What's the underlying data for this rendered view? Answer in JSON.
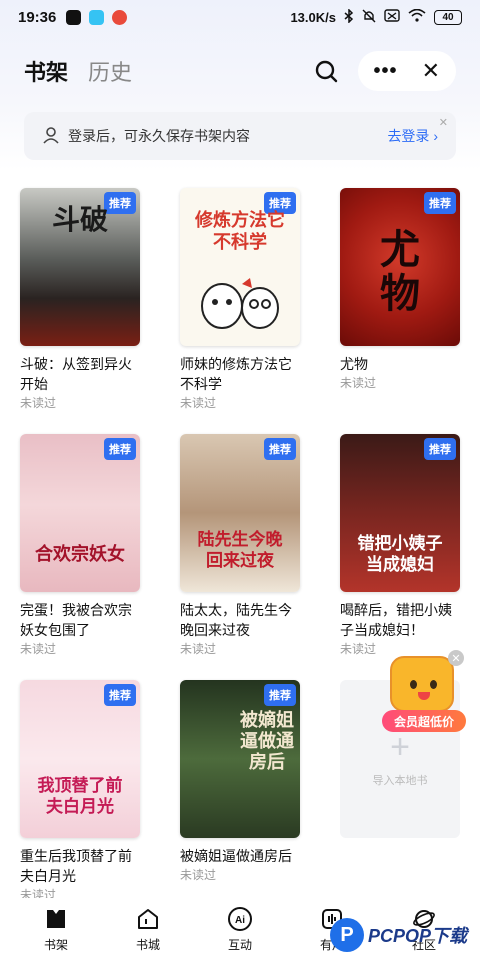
{
  "status_bar": {
    "time": "19:36",
    "network_speed": "13.0K/s",
    "battery": "40"
  },
  "header": {
    "tabs": [
      {
        "label": "书架",
        "active": true
      },
      {
        "label": "历史",
        "active": false
      }
    ],
    "search_icon": "search-icon",
    "more_icon": "more-icon",
    "close_icon": "close-icon"
  },
  "login_banner": {
    "text": "登录后，可永久保存书架内容",
    "link": "去登录 ›"
  },
  "books": [
    {
      "title": "斗破：从签到异火开始",
      "status": "未读过",
      "badge": "推荐",
      "cover_text": "斗破"
    },
    {
      "title": "师妹的修炼方法它不科学",
      "status": "未读过",
      "badge": "推荐",
      "cover_text": "修炼方法它不科学"
    },
    {
      "title": "尤物",
      "status": "未读过",
      "badge": "推荐",
      "cover_text": "尤物"
    },
    {
      "title": "完蛋！我被合欢宗妖女包围了",
      "status": "未读过",
      "badge": "推荐",
      "cover_text": "合欢宗妖女"
    },
    {
      "title": "陆太太，陆先生今晚回来过夜",
      "status": "未读过",
      "badge": "推荐",
      "cover_text": "陆先生今晚回来过夜"
    },
    {
      "title": "喝醉后，错把小姨子当成媳妇！",
      "status": "未读过",
      "badge": "推荐",
      "cover_text": "错把小姨子当成媳妇"
    },
    {
      "title": "重生后我顶替了前夫白月光",
      "status": "未读过",
      "badge": "推荐",
      "cover_text": "我顶替了前夫白月光"
    },
    {
      "title": "被嫡姐逼做通房后",
      "status": "未读过",
      "badge": "推荐",
      "cover_text": "被嫡姐逼做通房后"
    }
  ],
  "import_card": {
    "plus": "+",
    "label": "导入本地书"
  },
  "promo": {
    "label": "会员超低价"
  },
  "bottom_nav": [
    {
      "label": "书架",
      "icon": "bookshelf-icon"
    },
    {
      "label": "书城",
      "icon": "bookstore-icon"
    },
    {
      "label": "互动",
      "icon": "ai-icon"
    },
    {
      "label": "有声",
      "icon": "audio-icon"
    },
    {
      "label": "社区",
      "icon": "community-icon"
    }
  ],
  "watermark": {
    "logo": "P",
    "text": "PCPOP下载"
  },
  "colors": {
    "accent": "#2f6ff0",
    "link": "#2d6cf6",
    "muted": "#999999"
  }
}
